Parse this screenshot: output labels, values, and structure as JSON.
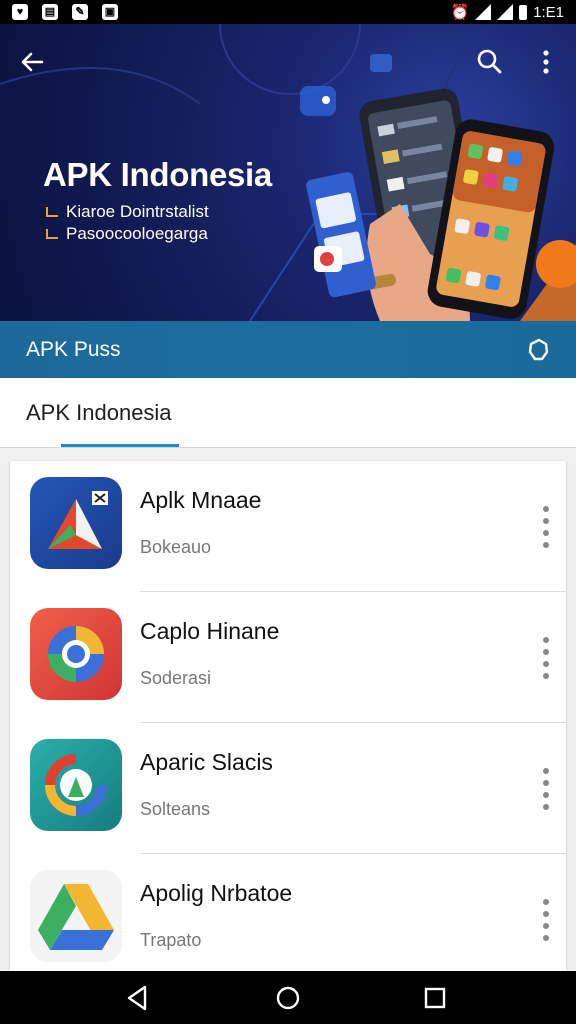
{
  "status_bar": {
    "time": "1:E1"
  },
  "hero": {
    "title": "APK Indonesia",
    "lines": [
      "Kiaroe Dointrstalist",
      "Pasoocooloegarga"
    ]
  },
  "app_bar": {
    "title": "APK Puss"
  },
  "tab": {
    "label": "APK Indonesia"
  },
  "apps": [
    {
      "name": "Aplk Mnaae",
      "subtitle": "Bokeauo",
      "icon": "apk-triangle-icon"
    },
    {
      "name": "Caplo Hinane",
      "subtitle": "Soderasi",
      "icon": "chrome-like-icon"
    },
    {
      "name": "Aparic Slacis",
      "subtitle": "Solteans",
      "icon": "g-ring-icon"
    },
    {
      "name": "Apolig Nrbatoe",
      "subtitle": "Trapato",
      "icon": "drive-triangle-icon"
    }
  ],
  "colors": {
    "hero_dark": "#111a52",
    "app_bar": "#1d6a9a",
    "tab_indicator": "#1f8fbf"
  }
}
